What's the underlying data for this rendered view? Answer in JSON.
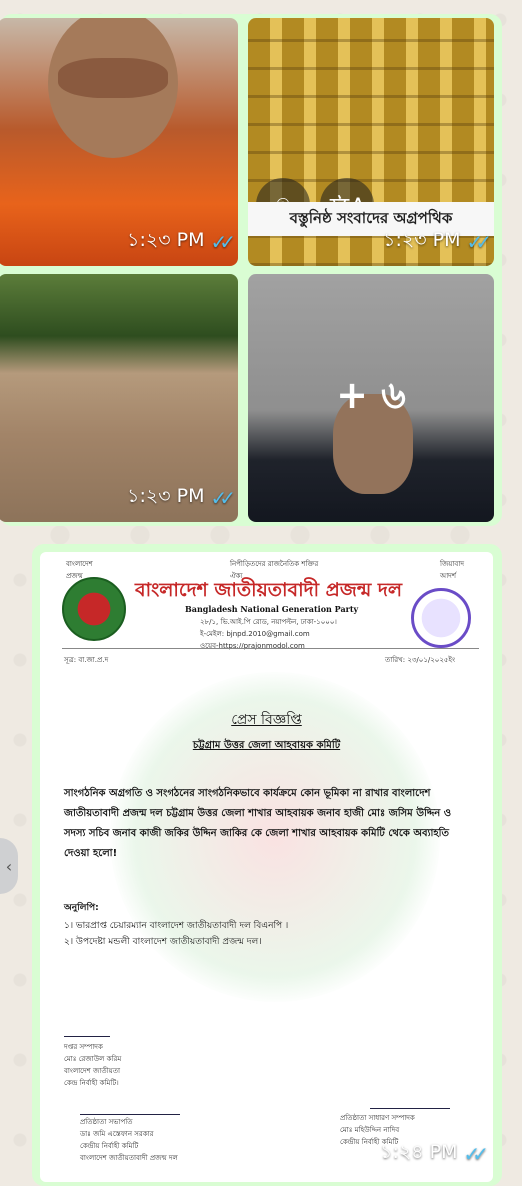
{
  "messages": {
    "album1": {
      "tiles": [
        {
          "time": "১:২৩ PM",
          "status": "read-ticks"
        },
        {
          "time": "১:২৩ PM",
          "status": "read-ticks",
          "banner": "বস্তুনিষ্ঠ সংবাদের অগ্রপথিক",
          "icons": [
            "lens-icon",
            "translate-icon"
          ]
        },
        {
          "time": "১:২৩ PM",
          "status": "read-ticks"
        },
        {
          "time": "",
          "status": "",
          "more_count": "+ ৬"
        }
      ]
    },
    "document_message": {
      "time": "১:২৪ PM",
      "status": "read-ticks",
      "doc": {
        "org_title": "বাংলাদেশ জাতীয়তাবাদী প্রজন্ম দল",
        "org_english": "Bangladesh National Generation Party",
        "heading": "প্রেস বিজ্ঞপ্তি",
        "subheading": "চট্টগ্রাম উত্তর জেলা আহবায়ক কমিটি",
        "body": "সাংগঠনিক অগ্রগতি ও সংগঠনের সাংগঠনিকভাবে কার্যক্রমে কোন ভূমিকা না রাখার বাংলাদেশ জাতীয়তাবাদী প্রজন্ম দল চট্টগ্রাম উত্তর জেলা শাখার আহবায়ক জনাব হাজী মোঃ জসিম উদ্দিন ও সদস্য সচিব জনাব কাজী জকির উদ্দিন জাকির কে জেলা শাখার আহবায়ক কমিটি থেকে অব্যাহতি দেওয়া হলো!",
        "copy_label": "অনুলিপি:",
        "copies": [
          "১। ভারপ্রাপ্ত চেয়ারম্যান বাংলাদেশ জাতীয়তাবাদী দল বিএনপি ।",
          "২। উপদেষ্টা মন্ডলী বাংলাদেশ জাতীয়তাবাদী প্রজন্ম দল।"
        ],
        "ref": "সূত্র: বা.জা.প্র.দ",
        "date": "তারিখ: ২৩/০১/২০২৫ইং"
      }
    }
  }
}
